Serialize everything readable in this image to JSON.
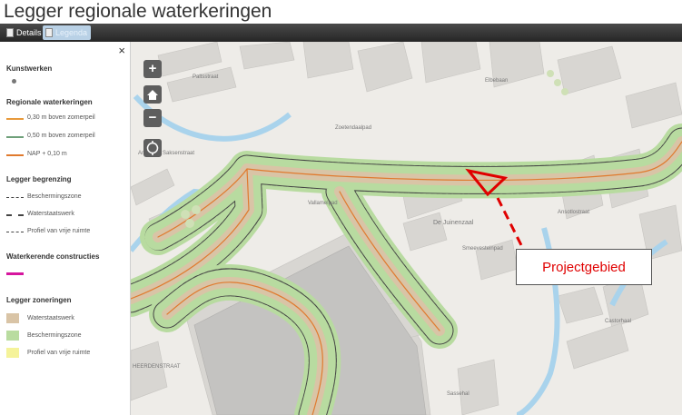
{
  "header": {
    "title": "Legger regionale waterkeringen"
  },
  "toolbar": {
    "details_label": "Details",
    "legend_label": "Legenda"
  },
  "legend": {
    "close_glyph": "×",
    "sections": {
      "kunstwerken": "Kunstwerken",
      "regionale": "Regionale waterkeringen",
      "begrenzing": "Legger begrenzing",
      "constructies": "Waterkerende constructies",
      "zoneringen": "Legger zoneringen"
    },
    "regionale_items": [
      "0,30 m boven zomerpeil",
      "0,50 m boven zomerpeil",
      "NAP + 0,10 m"
    ],
    "begrenzing_items": [
      "Beschermingszone",
      "Waterstaatswerk",
      "Profiel van vrije ruimte"
    ],
    "zonering_items": [
      "Waterstaatswerk",
      "Beschermingszone",
      "Profiel van vrije ruimte"
    ],
    "colors": {
      "line1": "#e89a3c",
      "line2": "#6fa07a",
      "line3": "#e07a2e",
      "constructie": "#d6169e",
      "waterstaatswerk": "#d9c4a6",
      "bescherming": "#b9dca0",
      "profiel": "#f5f39a"
    }
  },
  "map": {
    "controls": {
      "zoom_in": "+",
      "zoom_out": "−"
    },
    "callout": "Projectgebied",
    "streets": [
      "Anna van Saksenstraat",
      "Paltsstraat",
      "Zoetendaalpad",
      "Vallamelpad",
      "De Juinenzaal",
      "Smeevesteinpad",
      "Ansotlostraat",
      "Elbebaan",
      "Castorhaal",
      "Sassehal",
      "HEERDENSTRAAT"
    ]
  }
}
